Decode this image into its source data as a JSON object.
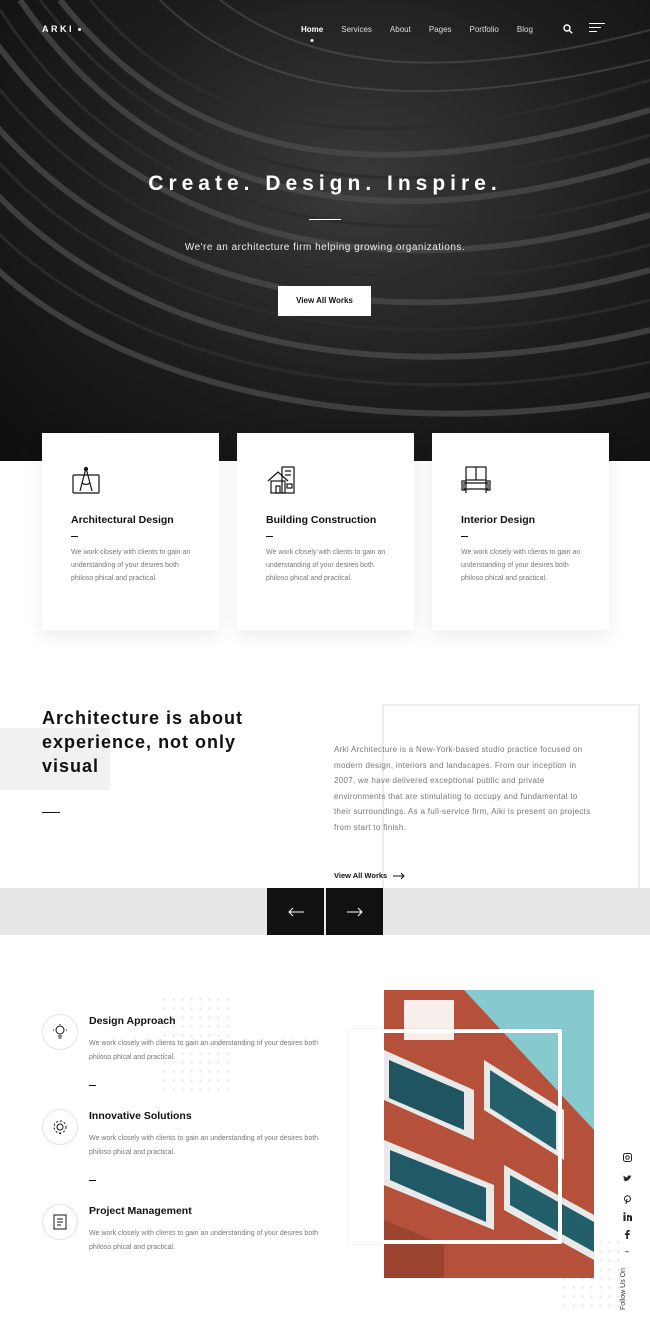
{
  "nav": {
    "logo": "ARKI",
    "items": [
      "Home",
      "Services",
      "About",
      "Pages",
      "Portfolio",
      "Blog"
    ],
    "active": "Home"
  },
  "hero": {
    "title": "Create. Design. Inspire.",
    "subtitle": "We're an architecture firm helping growing organizations.",
    "button": "View All Works"
  },
  "services": [
    {
      "title": "Architectural Design",
      "text": "We work closely with clients to gain an understanding of your desires both philoso phical and practical."
    },
    {
      "title": "Building Construction",
      "text": "We work closely with clients to gain an understanding of your desires both philoso phical and practical."
    },
    {
      "title": "Interior Design",
      "text": "We work closely with clients to gain an understanding of your desires both philoso phical and practical."
    }
  ],
  "about": {
    "title": "Architecture is about experience, not only visual",
    "text": "Arki Architecture is a New-York-based studio practice focused on modern design, interiors and landscapes. From our inception in 2007, we have delivered exceptional public and private environments that are stimulating to occupy and fundamental to their surroundings. As a full-service firm, Aiki is present on projects from start to finish.",
    "link": "View All Works"
  },
  "features": [
    {
      "title": "Design Approach",
      "text": "We work closely with clients to gain an understanding of your desires both philoso phical and practical."
    },
    {
      "title": "Innovative Solutions",
      "text": "We work closely with clients to gain an understanding of your desires both philoso phical and practical."
    },
    {
      "title": "Project Management",
      "text": "We work closely with clients to gain an understanding of your desires both philoso phical and practical."
    }
  ],
  "social": {
    "label": "Follow Us On",
    "icons": [
      "instagram-icon",
      "twitter-icon",
      "pinterest-icon",
      "linkedin-icon",
      "facebook-icon"
    ]
  },
  "colors": {
    "dark": "#111111",
    "band": "#e7e7e7",
    "text_muted": "#777777",
    "accent_teal": "#7fc3c9",
    "accent_brick": "#b6523a"
  }
}
